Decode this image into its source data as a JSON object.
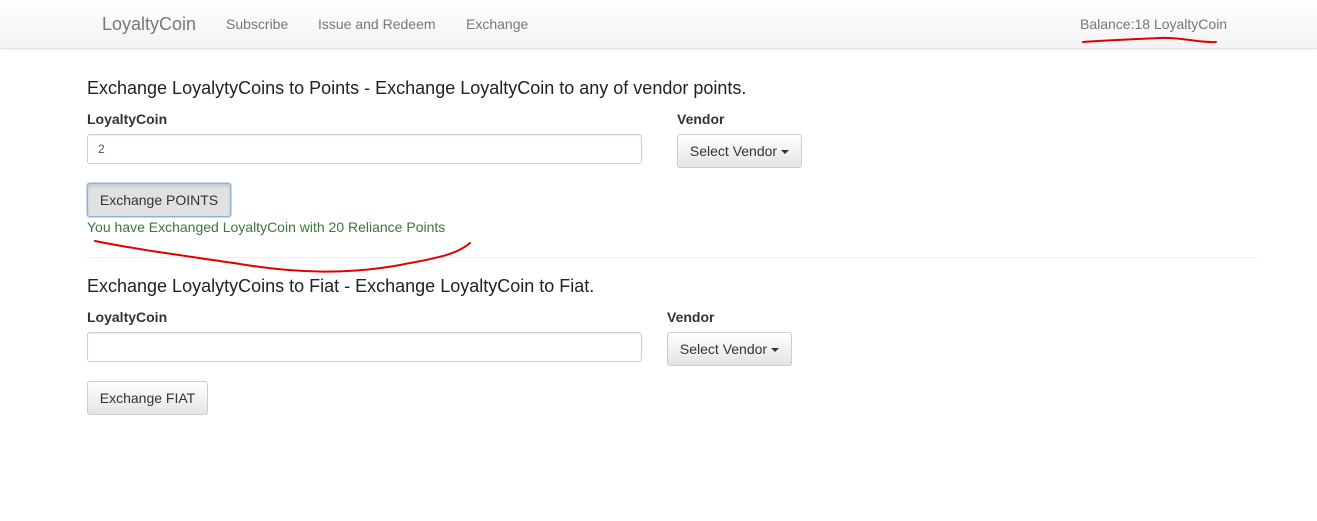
{
  "navbar": {
    "brand": "LoyaltyCoin",
    "links": [
      "Subscribe",
      "Issue and Redeem",
      "Exchange"
    ],
    "balance": "Balance:18 LoyaltyCoin"
  },
  "points_section": {
    "title": "Exchange LoyalytyCoins to Points - Exchange LoyaltyCoin to any of vendor points.",
    "coin_label": "LoyaltyCoin",
    "coin_value": "2",
    "vendor_label": "Vendor",
    "vendor_dropdown": "Select Vendor",
    "submit_label": "Exchange POINTS",
    "success_message": "You have Exchanged LoyaltyCoin with 20 Reliance Points"
  },
  "fiat_section": {
    "title": "Exchange LoyalytyCoins to Fiat - Exchange LoyaltyCoin to Fiat.",
    "coin_label": "LoyaltyCoin",
    "coin_value": "",
    "vendor_label": "Vendor",
    "vendor_dropdown": "Select Vendor",
    "submit_label": "Exchange FIAT"
  },
  "colors": {
    "success_text": "#3c763d",
    "annotation_pen": "#e00000",
    "navbar_text": "#777777"
  }
}
